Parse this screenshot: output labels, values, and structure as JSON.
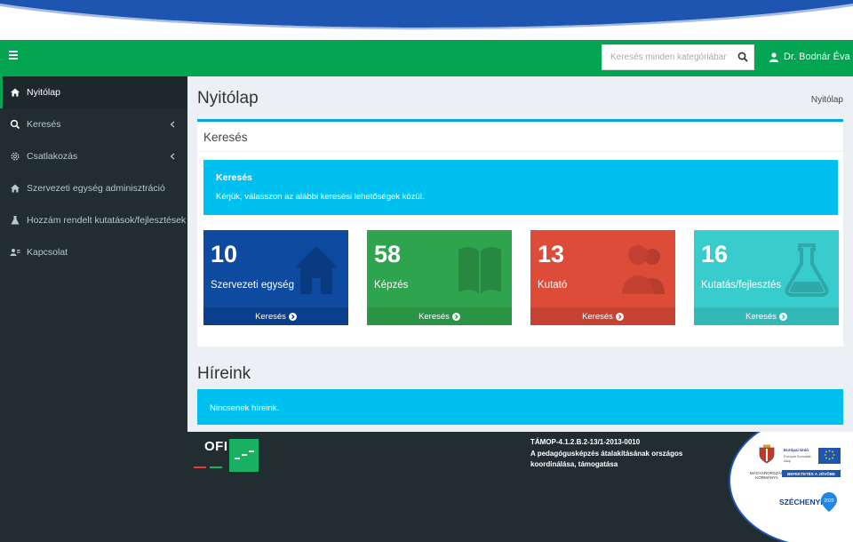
{
  "navbar": {
    "search_placeholder": "Keresés minden kategóriában.",
    "user_name": "Dr. Bodnár Éva"
  },
  "sidebar": {
    "items": [
      {
        "label": "Nyitólap",
        "icon": "home-icon",
        "active": true
      },
      {
        "label": "Keresés",
        "icon": "search-icon",
        "has_submenu": true
      },
      {
        "label": "Csatlakozás",
        "icon": "gear-icon",
        "has_submenu": true
      },
      {
        "label": "Szervezeti egység adminisztráció",
        "icon": "home-icon"
      },
      {
        "label": "Hozzám rendelt kutatások/fejlesztések",
        "icon": "flask-icon"
      },
      {
        "label": "Kapcsolat",
        "icon": "contact-icon"
      }
    ]
  },
  "content": {
    "page_title": "Nyitólap",
    "breadcrumb": "Nyitólap",
    "search_box": {
      "title": "Keresés",
      "callout_title": "Keresés",
      "callout_text": "Kérjük, válasszon az alábbi keresési lehetőségek közül."
    },
    "tiles": [
      {
        "count": "10",
        "label": "Szervezeti egység",
        "footer": "Keresés",
        "icon": "house-icon",
        "color": "#0d4aa0",
        "foot_color": "#0b3f8c"
      },
      {
        "count": "58",
        "label": "Képzés",
        "footer": "Keresés",
        "icon": "book-icon",
        "color": "#2fa44f",
        "foot_color": "#2a9346"
      },
      {
        "count": "13",
        "label": "Kutató",
        "footer": "Keresés",
        "icon": "users-icon",
        "color": "#dd4b39",
        "foot_color": "#c64333"
      },
      {
        "count": "16",
        "label": "Kutatás/fejlesztés",
        "footer": "Keresés",
        "icon": "flask-icon",
        "color": "#39cccc",
        "foot_color": "#33b8b8"
      }
    ],
    "news_title": "Híreink",
    "news_empty": "Nincsenek híreink."
  },
  "footer": {
    "logo_text": "OFI",
    "project_code": "TÁMOP-4.1.2.B.2-13/1-2013-0010",
    "project_line1": "A pedagógusképzés átalakításának országos",
    "project_line2": "koordinálása, támogatása",
    "coat_text": "MAGYARORSZÁG KORMÁNYA",
    "eu_title": "Európai Unió",
    "eu_sub": "Európai Szociális Alap",
    "eu_slogan": "BEFEKTETÉS A JÖVŐBE",
    "szechenyi": "SZÉCHENYI",
    "szechenyi_year": "2020"
  },
  "colors": {
    "navbar": "#03a552",
    "sidebar": "#222d32",
    "accent": "#00c0ef"
  }
}
